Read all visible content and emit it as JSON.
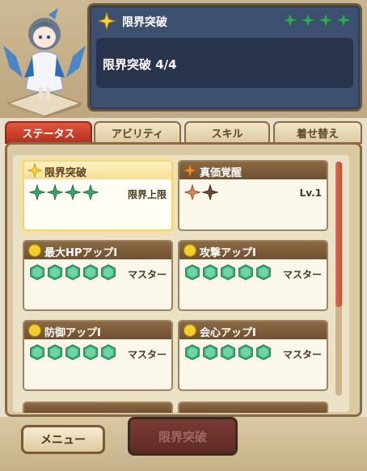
{
  "info": {
    "title": "限界突破",
    "text": "限界突破 4/4"
  },
  "tabs": [
    {
      "label": "ステータス"
    },
    {
      "label": "アビリティ"
    },
    {
      "label": "スキル"
    },
    {
      "label": "着せ替え"
    }
  ],
  "cards": [
    {
      "title": "限界突破",
      "status": "限界上限"
    },
    {
      "title": "真価覚醒",
      "status": "Lv.1"
    },
    {
      "title": "最大HPアップⅠ",
      "status": "マスター"
    },
    {
      "title": "攻撃アップⅠ",
      "status": "マスター"
    },
    {
      "title": "防御アップⅠ",
      "status": "マスター"
    },
    {
      "title": "会心アップⅠ",
      "status": "マスター"
    }
  ],
  "buttons": {
    "menu": "メニュー",
    "limit_break": "限界突破"
  },
  "colors": {
    "accent_red": "#c4392a",
    "panel_blue": "#3d5070",
    "star_green": "#3aa36a",
    "gem_green": "#39b07a",
    "medal_yellow": "#f2cf2a"
  }
}
